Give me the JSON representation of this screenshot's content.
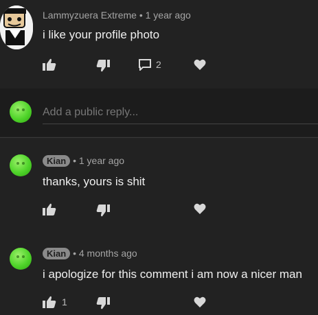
{
  "top_comment": {
    "author": "Lammyzuera Extreme",
    "separator": "•",
    "time": "1 year ago",
    "text": "i like your profile photo",
    "reply_count": "2"
  },
  "reply_box": {
    "placeholder": "Add a public reply..."
  },
  "replies": [
    {
      "author": "Kian",
      "separator": "•",
      "time": "1 year ago",
      "text": "thanks, yours is shit",
      "like_count": ""
    },
    {
      "author": "Kian",
      "separator": "•",
      "time": "4 months ago",
      "text": "i apologize for this comment i am now a nicer man",
      "like_count": "1"
    }
  ],
  "icons": {
    "like": "thumb-up-icon",
    "dislike": "thumb-down-icon",
    "reply": "comment-icon",
    "heart": "heart-icon"
  },
  "colors": {
    "background": "#222222",
    "avatar_green": "#4fd42a",
    "author_chip": "#8a8a8a"
  }
}
